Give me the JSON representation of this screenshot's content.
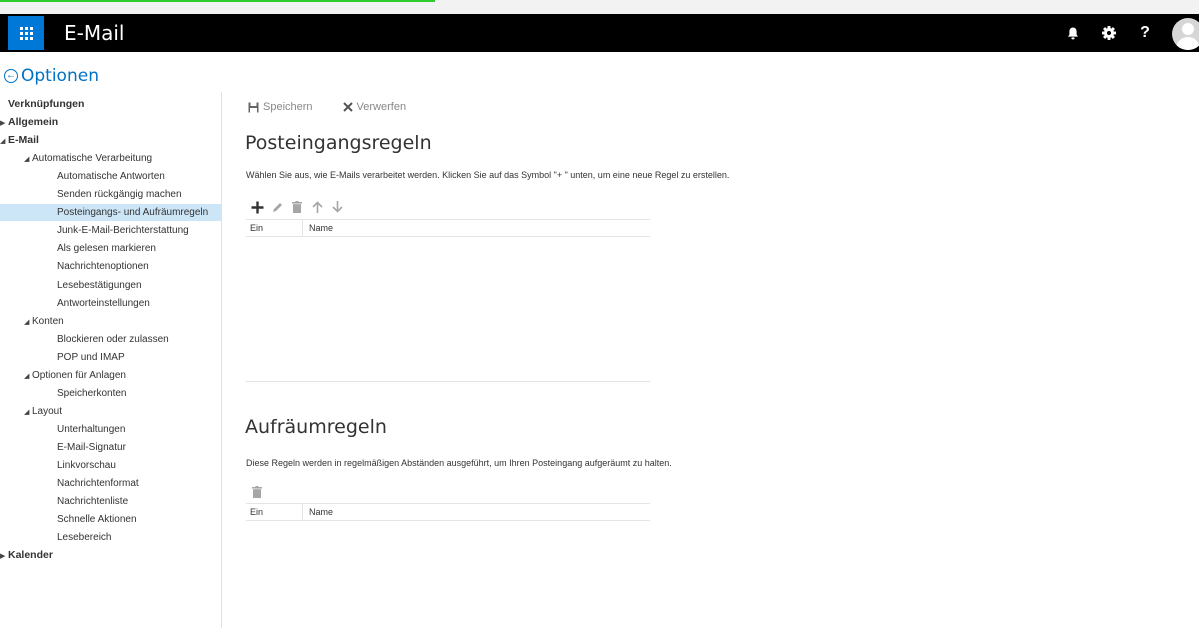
{
  "app": {
    "title": "E-Mail"
  },
  "topbar": {
    "icons": [
      "bell-icon",
      "gear-icon",
      "help-icon",
      "avatar"
    ],
    "help_label": "?"
  },
  "options": {
    "label": "Optionen"
  },
  "sidebar": {
    "items": [
      {
        "label": "Verknüpfungen",
        "level": 0,
        "bold": true,
        "arrow": ""
      },
      {
        "label": "Allgemein",
        "level": 0,
        "bold": true,
        "arrow": "collapsed"
      },
      {
        "label": "E-Mail",
        "level": 0,
        "bold": true,
        "arrow": "expanded"
      },
      {
        "label": "Automatische Verarbeitung",
        "level": 1,
        "bold": false,
        "arrow": "expanded"
      },
      {
        "label": "Automatische Antworten",
        "level": 2,
        "bold": false,
        "arrow": ""
      },
      {
        "label": "Senden rückgängig machen",
        "level": 2,
        "bold": false,
        "arrow": ""
      },
      {
        "label": "Posteingangs- und Aufräumregeln",
        "level": 2,
        "bold": false,
        "arrow": "",
        "selected": true
      },
      {
        "label": "Junk-E-Mail-Berichterstattung",
        "level": 2,
        "bold": false,
        "arrow": ""
      },
      {
        "label": "Als gelesen markieren",
        "level": 2,
        "bold": false,
        "arrow": ""
      },
      {
        "label": "Nachrichtenoptionen",
        "level": 2,
        "bold": false,
        "arrow": ""
      },
      {
        "label": "Lesebestätigungen",
        "level": 2,
        "bold": false,
        "arrow": ""
      },
      {
        "label": "Antworteinstellungen",
        "level": 2,
        "bold": false,
        "arrow": ""
      },
      {
        "label": "Konten",
        "level": 1,
        "bold": false,
        "arrow": "expanded"
      },
      {
        "label": "Blockieren oder zulassen",
        "level": 2,
        "bold": false,
        "arrow": ""
      },
      {
        "label": "POP und IMAP",
        "level": 2,
        "bold": false,
        "arrow": ""
      },
      {
        "label": "Optionen für Anlagen",
        "level": 1,
        "bold": false,
        "arrow": "expanded"
      },
      {
        "label": "Speicherkonten",
        "level": 2,
        "bold": false,
        "arrow": ""
      },
      {
        "label": "Layout",
        "level": 1,
        "bold": false,
        "arrow": "expanded"
      },
      {
        "label": "Unterhaltungen",
        "level": 2,
        "bold": false,
        "arrow": ""
      },
      {
        "label": "E-Mail-Signatur",
        "level": 2,
        "bold": false,
        "arrow": ""
      },
      {
        "label": "Linkvorschau",
        "level": 2,
        "bold": false,
        "arrow": ""
      },
      {
        "label": "Nachrichtenformat",
        "level": 2,
        "bold": false,
        "arrow": ""
      },
      {
        "label": "Nachrichtenliste",
        "level": 2,
        "bold": false,
        "arrow": ""
      },
      {
        "label": "Schnelle Aktionen",
        "level": 2,
        "bold": false,
        "arrow": ""
      },
      {
        "label": "Lesebereich",
        "level": 2,
        "bold": false,
        "arrow": ""
      },
      {
        "label": "Kalender",
        "level": 0,
        "bold": true,
        "arrow": "collapsed"
      }
    ]
  },
  "toolbar": {
    "save_label": "Speichern",
    "discard_label": "Verwerfen"
  },
  "inbox_rules": {
    "title": "Posteingangsregeln",
    "description": "Wählen Sie aus, wie E-Mails verarbeitet werden. Klicken Sie auf das Symbol \"+ \" unten, um eine neue Regel zu erstellen.",
    "tools": [
      "add-icon",
      "edit-icon",
      "delete-icon",
      "move-up-icon",
      "move-down-icon"
    ],
    "columns": [
      "Ein",
      "Name"
    ],
    "rows": []
  },
  "sweep_rules": {
    "title": "Aufräumregeln",
    "description": "Diese Regeln werden in regelmäßigen Abständen ausgeführt, um Ihren Posteingang aufgeräumt zu halten.",
    "tools": [
      "delete-icon"
    ],
    "columns": [
      "Ein",
      "Name"
    ],
    "rows": []
  },
  "colors": {
    "topbar": "#000000",
    "waffle": "#0078d7",
    "accent": "#0072c6",
    "selected": "#cde6f7"
  }
}
